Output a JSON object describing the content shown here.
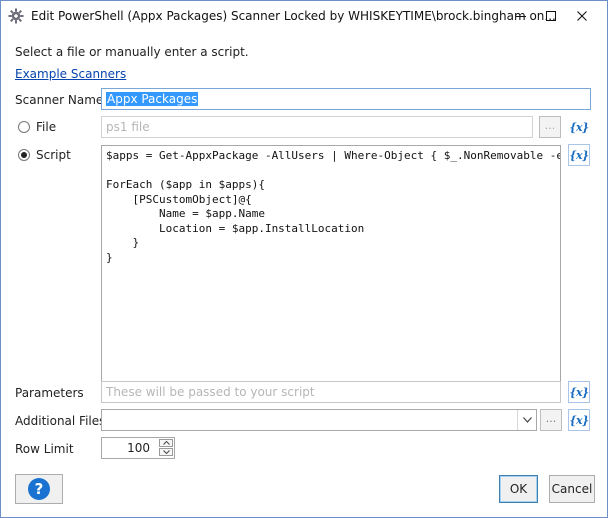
{
  "window": {
    "title": "Edit PowerShell (Appx Packages) Scanner Locked by WHISKEYTIME\\brock.bingham on...",
    "minimize_label": "minimize",
    "maximize_label": "maximize",
    "close_label": "close"
  },
  "form": {
    "instruction": "Select a file or manually enter a script.",
    "example_link": "Example Scanners",
    "scanner_name_label": "Scanner Name",
    "scanner_name_value": "Appx Packages",
    "file_label": "File",
    "file_placeholder": "ps1 file",
    "browse_label": "...",
    "script_label": "Script",
    "script_lines": [
      "$apps = Get-AppxPackage -AllUsers | Where-Object { $_.NonRemovable -e",
      "",
      "ForEach ($app in $apps){",
      "    [PSCustomObject]@{",
      "        Name = $app.Name",
      "        Location = $app.InstallLocation",
      "    }",
      "}"
    ],
    "variable_button_label": "{x}",
    "parameters_label": "Parameters",
    "parameters_placeholder": "These will be passed to your script",
    "additional_files_label": "Additional Files",
    "additional_files_value": "",
    "row_limit_label": "Row Limit",
    "row_limit_value": "100"
  },
  "buttons": {
    "help": "?",
    "ok": "OK",
    "cancel": "Cancel"
  },
  "colors": {
    "accent": "#1b6dc1",
    "link": "#0645ad",
    "selection": "#3399ff",
    "help_button": "#1a73d1"
  }
}
